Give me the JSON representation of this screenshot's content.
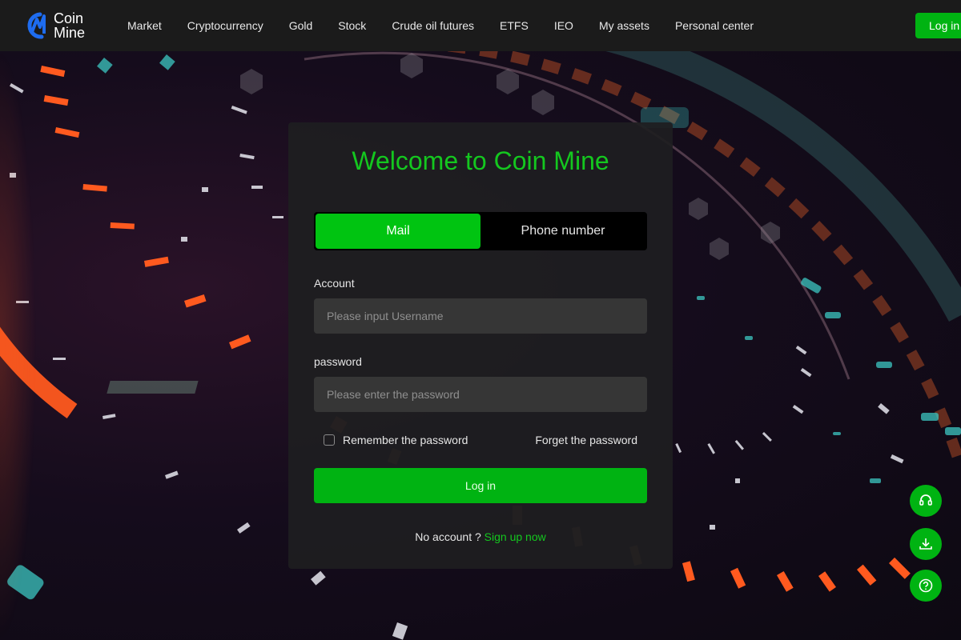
{
  "brand": {
    "name_line1": "Coin",
    "name_line2": "Mine"
  },
  "nav": {
    "items": [
      {
        "id": "market",
        "label": "Market"
      },
      {
        "id": "cryptocurrency",
        "label": "Cryptocurrency"
      },
      {
        "id": "gold",
        "label": "Gold"
      },
      {
        "id": "stock",
        "label": "Stock"
      },
      {
        "id": "crude-oil-futures",
        "label": "Crude oil futures"
      },
      {
        "id": "etfs",
        "label": "ETFS"
      },
      {
        "id": "ieo",
        "label": "IEO"
      },
      {
        "id": "my-assets",
        "label": "My assets"
      },
      {
        "id": "personal-center",
        "label": "Personal center"
      }
    ],
    "login_label": "Log in"
  },
  "login_card": {
    "title": "Welcome to Coin Mine",
    "tabs": [
      {
        "label": "Mail",
        "active": true
      },
      {
        "label": "Phone number",
        "active": false
      }
    ],
    "account_label": "Account",
    "account_placeholder": "Please input Username",
    "account_value": "",
    "password_label": "password",
    "password_placeholder": "Please enter the password",
    "password_value": "",
    "remember_label": "Remember the password",
    "remember_checked": false,
    "forget_label": "Forget the password",
    "login_button": "Log in",
    "no_account_text": "No account ?",
    "signup_link": "Sign up now"
  },
  "floating_buttons": [
    {
      "icon": "headset-icon"
    },
    {
      "icon": "download-icon"
    },
    {
      "icon": "help-icon"
    }
  ],
  "colors": {
    "accent": "#00c411",
    "accent_text": "#14c71f",
    "header_bg": "#1b1b1b",
    "card_bg": "#1e1e20"
  }
}
